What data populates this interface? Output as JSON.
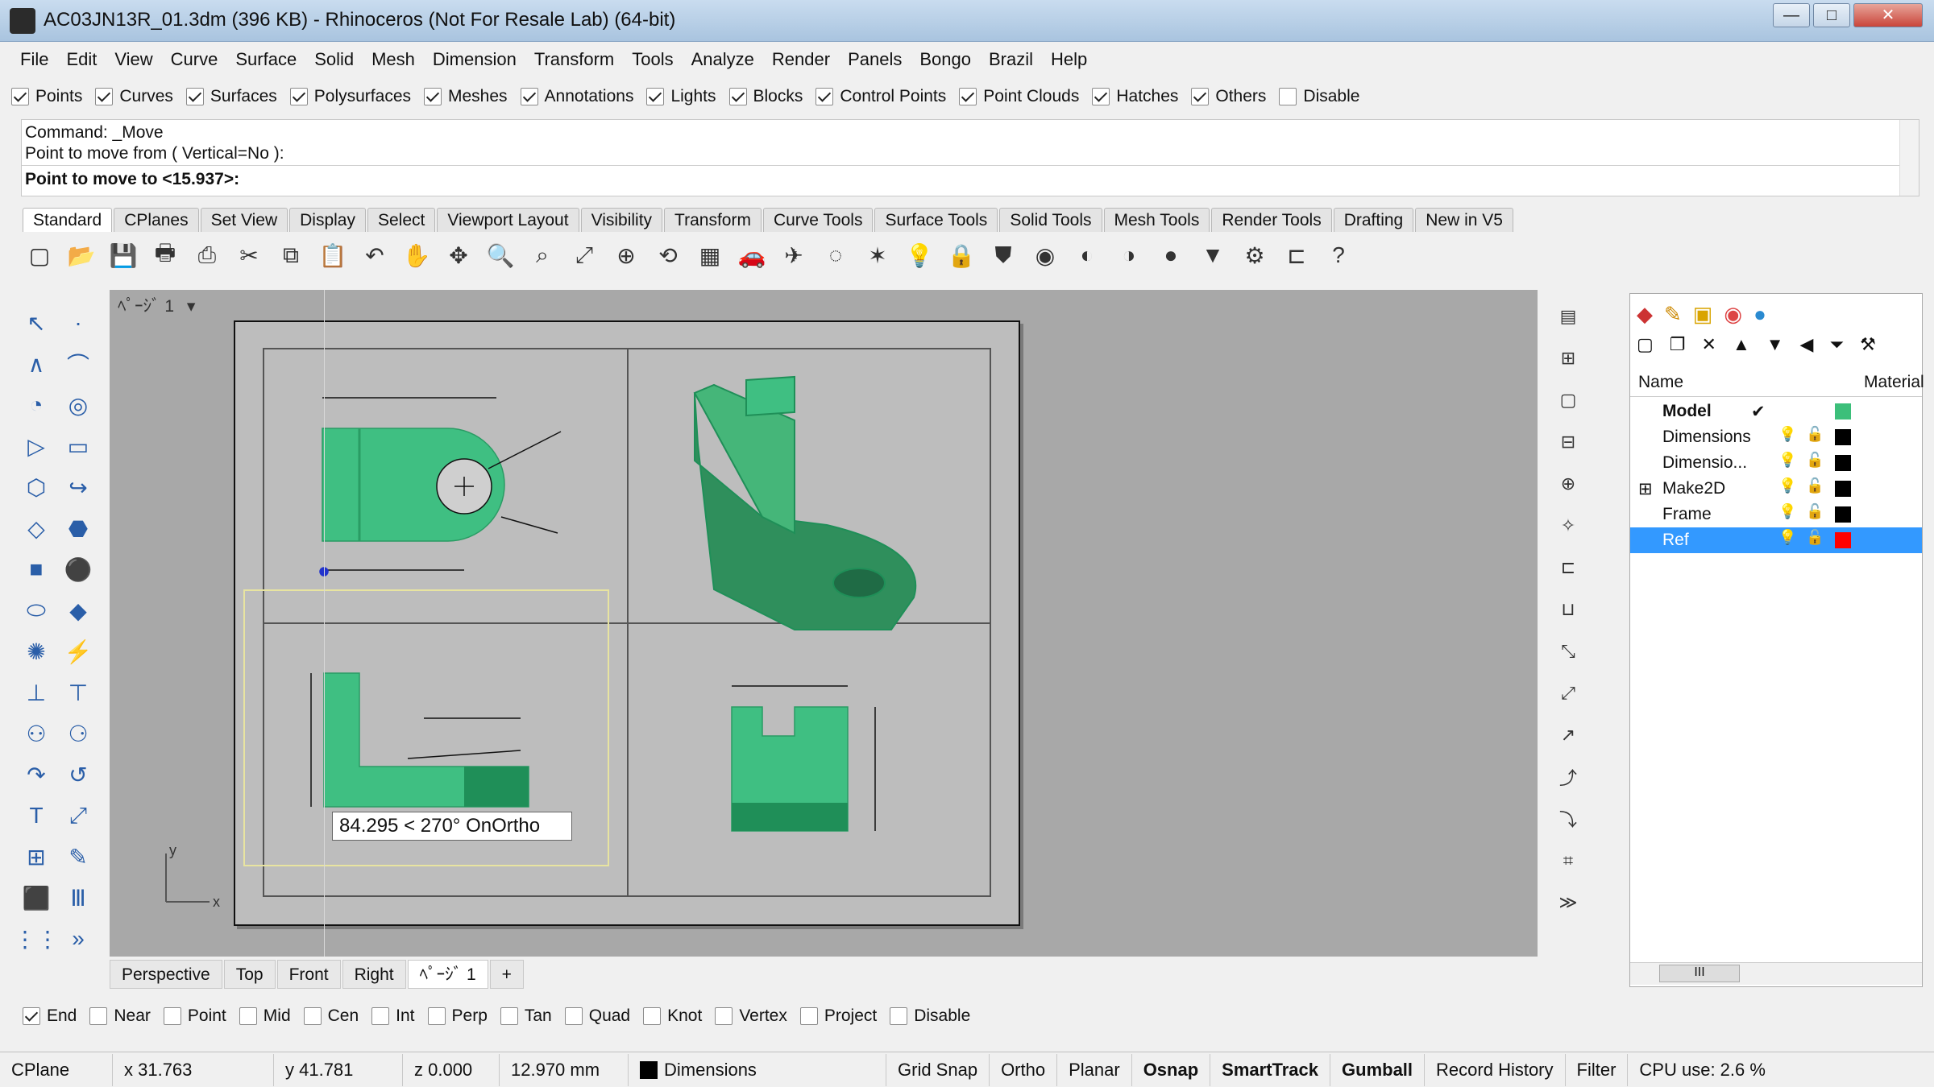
{
  "window": {
    "title": "AC03JN13R_01.3dm (396 KB) - Rhinoceros (Not For Resale Lab) (64-bit)",
    "min": "—",
    "max": "□",
    "close": "✕"
  },
  "menu": [
    "File",
    "Edit",
    "View",
    "Curve",
    "Surface",
    "Solid",
    "Mesh",
    "Dimension",
    "Transform",
    "Tools",
    "Analyze",
    "Render",
    "Panels",
    "Bongo",
    "Brazil",
    "Help"
  ],
  "filters": [
    {
      "label": "Points",
      "checked": true
    },
    {
      "label": "Curves",
      "checked": true
    },
    {
      "label": "Surfaces",
      "checked": true
    },
    {
      "label": "Polysurfaces",
      "checked": true
    },
    {
      "label": "Meshes",
      "checked": true
    },
    {
      "label": "Annotations",
      "checked": true
    },
    {
      "label": "Lights",
      "checked": true
    },
    {
      "label": "Blocks",
      "checked": true
    },
    {
      "label": "Control Points",
      "checked": true
    },
    {
      "label": "Point Clouds",
      "checked": true
    },
    {
      "label": "Hatches",
      "checked": true
    },
    {
      "label": "Others",
      "checked": true
    },
    {
      "label": "Disable",
      "checked": false
    }
  ],
  "command": {
    "line1": "Command: _Move",
    "line2": "Point to move from ( Vertical=No ):",
    "prompt": "Point to move to <15.937>:"
  },
  "tabs": [
    "Standard",
    "CPlanes",
    "Set View",
    "Display",
    "Select",
    "Viewport Layout",
    "Visibility",
    "Transform",
    "Curve Tools",
    "Surface Tools",
    "Solid Tools",
    "Mesh Tools",
    "Render Tools",
    "Drafting",
    "New in V5"
  ],
  "toolbar_icons": [
    "new-icon",
    "open-icon",
    "save-icon",
    "print-icon",
    "import-icon",
    "cut-icon",
    "copy-icon",
    "paste-icon",
    "undo-icon",
    "pan-icon",
    "move-icon",
    "zoom-icon",
    "zoom-window-icon",
    "zoom-extents-icon",
    "zoom-selected-icon",
    "rotate-view-icon",
    "viewport-layout-icon",
    "car-icon",
    "render-icon",
    "snap-icon",
    "points-icon",
    "light-icon",
    "lock-icon",
    "shield-icon",
    "color-wheel-icon",
    "shade-icon",
    "rendered-icon",
    "sphere-icon",
    "pin-icon",
    "gear-icon",
    "dimension-icon",
    "help-icon"
  ],
  "viewport": {
    "page_title": "ﾍﾟｰｼﾞ 1",
    "ortho_tooltip": "84.295 < 270° OnOrtho",
    "axis_x": "x",
    "axis_y": "y"
  },
  "viewport_tabs": [
    "Perspective",
    "Top",
    "Front",
    "Right",
    "ﾍﾟｰｼﾞ 1",
    "+"
  ],
  "layers": {
    "col_name": "Name",
    "col_material": "Material",
    "rows": [
      {
        "name": "Model",
        "current": "✔",
        "color": "#3cbf7a",
        "bold": true
      },
      {
        "name": "Dimensions",
        "color": "#000000"
      },
      {
        "name": "Dimensio...",
        "color": "#000000"
      },
      {
        "name": "Make2D",
        "color": "#000000",
        "expand": "⊞"
      },
      {
        "name": "Frame",
        "color": "#000000"
      },
      {
        "name": "Ref",
        "color": "#ff0000",
        "selected": true
      }
    ],
    "scroll": "III"
  },
  "osnaps": [
    {
      "label": "End",
      "checked": true
    },
    {
      "label": "Near",
      "checked": false
    },
    {
      "label": "Point",
      "checked": false
    },
    {
      "label": "Mid",
      "checked": false
    },
    {
      "label": "Cen",
      "checked": false
    },
    {
      "label": "Int",
      "checked": false
    },
    {
      "label": "Perp",
      "checked": false
    },
    {
      "label": "Tan",
      "checked": false
    },
    {
      "label": "Quad",
      "checked": false
    },
    {
      "label": "Knot",
      "checked": false
    },
    {
      "label": "Vertex",
      "checked": false
    },
    {
      "label": "Project",
      "checked": false
    },
    {
      "label": "Disable",
      "checked": false
    }
  ],
  "status": {
    "cplane": "CPlane",
    "x": "x 31.763",
    "y": "y 41.781",
    "z": "z 0.000",
    "dist": "12.970 mm",
    "layer": "Dimensions",
    "toggles": [
      {
        "label": "Grid Snap",
        "bold": false
      },
      {
        "label": "Ortho",
        "bold": false
      },
      {
        "label": "Planar",
        "bold": false
      },
      {
        "label": "Osnap",
        "bold": true
      },
      {
        "label": "SmartTrack",
        "bold": true
      },
      {
        "label": "Gumball",
        "bold": true
      },
      {
        "label": "Record History",
        "bold": false
      },
      {
        "label": "Filter",
        "bold": false
      }
    ],
    "cpu": "CPU use: 2.6 %"
  },
  "colors": {
    "model_green": "#3fbf82",
    "accent_blue": "#3399ff",
    "yellow_select": "#e8e4a0"
  }
}
